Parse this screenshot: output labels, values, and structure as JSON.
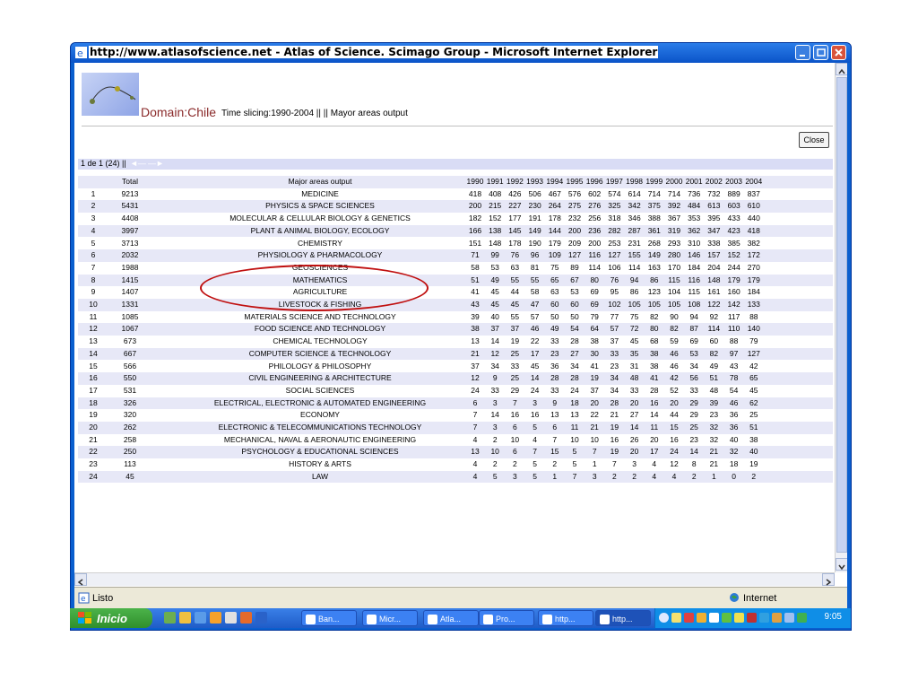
{
  "window": {
    "title": "http://www.atlasofscience.net - Atlas of Science. Scimago Group - Microsoft Internet Explorer"
  },
  "page": {
    "domain_label": "Domain:Chile",
    "time_slicing": "Time slicing:1990-2004 || || Mayor areas output",
    "close_button": "Close",
    "pager_text": "1 de 1 (24) ||"
  },
  "table": {
    "headers": {
      "total": "Total",
      "area": "Major areas output",
      "years": [
        "1990",
        "1991",
        "1992",
        "1993",
        "1994",
        "1995",
        "1996",
        "1997",
        "1998",
        "1999",
        "2000",
        "2001",
        "2002",
        "2003",
        "2004"
      ]
    },
    "rows": [
      {
        "idx": "1",
        "total": "9213",
        "area": "MEDICINE",
        "vals": [
          "418",
          "408",
          "426",
          "506",
          "467",
          "576",
          "602",
          "574",
          "614",
          "714",
          "714",
          "736",
          "732",
          "889",
          "837"
        ]
      },
      {
        "idx": "2",
        "total": "5431",
        "area": "PHYSICS & SPACE SCIENCES",
        "vals": [
          "200",
          "215",
          "227",
          "230",
          "264",
          "275",
          "276",
          "325",
          "342",
          "375",
          "392",
          "484",
          "613",
          "603",
          "610"
        ]
      },
      {
        "idx": "3",
        "total": "4408",
        "area": "MOLECULAR & CELLULAR BIOLOGY & GENETICS",
        "vals": [
          "182",
          "152",
          "177",
          "191",
          "178",
          "232",
          "256",
          "318",
          "346",
          "388",
          "367",
          "353",
          "395",
          "433",
          "440"
        ]
      },
      {
        "idx": "4",
        "total": "3997",
        "area": "PLANT & ANIMAL BIOLOGY, ECOLOGY",
        "vals": [
          "166",
          "138",
          "145",
          "149",
          "144",
          "200",
          "236",
          "282",
          "287",
          "361",
          "319",
          "362",
          "347",
          "423",
          "418"
        ]
      },
      {
        "idx": "5",
        "total": "3713",
        "area": "CHEMISTRY",
        "vals": [
          "151",
          "148",
          "178",
          "190",
          "179",
          "209",
          "200",
          "253",
          "231",
          "268",
          "293",
          "310",
          "338",
          "385",
          "382"
        ]
      },
      {
        "idx": "6",
        "total": "2032",
        "area": "PHYSIOLOGY & PHARMACOLOGY",
        "vals": [
          "71",
          "99",
          "76",
          "96",
          "109",
          "127",
          "116",
          "127",
          "155",
          "149",
          "280",
          "146",
          "157",
          "152",
          "172"
        ]
      },
      {
        "idx": "7",
        "total": "1988",
        "area": "GEOSCIENCES",
        "vals": [
          "58",
          "53",
          "63",
          "81",
          "75",
          "89",
          "114",
          "106",
          "114",
          "163",
          "170",
          "184",
          "204",
          "244",
          "270"
        ]
      },
      {
        "idx": "8",
        "total": "1415",
        "area": "MATHEMATICS",
        "vals": [
          "51",
          "49",
          "55",
          "55",
          "65",
          "67",
          "80",
          "76",
          "94",
          "86",
          "115",
          "116",
          "148",
          "179",
          "179"
        ]
      },
      {
        "idx": "9",
        "total": "1407",
        "area": "AGRICULTURE",
        "vals": [
          "41",
          "45",
          "44",
          "58",
          "63",
          "53",
          "69",
          "95",
          "86",
          "123",
          "104",
          "115",
          "161",
          "160",
          "184"
        ]
      },
      {
        "idx": "10",
        "total": "1331",
        "area": "LIVESTOCK & FISHING",
        "vals": [
          "43",
          "45",
          "45",
          "47",
          "60",
          "60",
          "69",
          "102",
          "105",
          "105",
          "105",
          "108",
          "122",
          "142",
          "133"
        ]
      },
      {
        "idx": "11",
        "total": "1085",
        "area": "MATERIALS SCIENCE AND TECHNOLOGY",
        "vals": [
          "39",
          "40",
          "55",
          "57",
          "50",
          "50",
          "79",
          "77",
          "75",
          "82",
          "90",
          "94",
          "92",
          "117",
          "88"
        ]
      },
      {
        "idx": "12",
        "total": "1067",
        "area": "FOOD SCIENCE AND TECHNOLOGY",
        "vals": [
          "38",
          "37",
          "37",
          "46",
          "49",
          "54",
          "64",
          "57",
          "72",
          "80",
          "82",
          "87",
          "114",
          "110",
          "140"
        ]
      },
      {
        "idx": "13",
        "total": "673",
        "area": "CHEMICAL TECHNOLOGY",
        "vals": [
          "13",
          "14",
          "19",
          "22",
          "33",
          "28",
          "38",
          "37",
          "45",
          "68",
          "59",
          "69",
          "60",
          "88",
          "79"
        ]
      },
      {
        "idx": "14",
        "total": "667",
        "area": "COMPUTER SCIENCE & TECHNOLOGY",
        "vals": [
          "21",
          "12",
          "25",
          "17",
          "23",
          "27",
          "30",
          "33",
          "35",
          "38",
          "46",
          "53",
          "82",
          "97",
          "127"
        ]
      },
      {
        "idx": "15",
        "total": "566",
        "area": "PHILOLOGY & PHILOSOPHY",
        "vals": [
          "37",
          "34",
          "33",
          "45",
          "36",
          "34",
          "41",
          "23",
          "31",
          "38",
          "46",
          "34",
          "49",
          "43",
          "42"
        ]
      },
      {
        "idx": "16",
        "total": "550",
        "area": "CIVIL ENGINEERING & ARCHITECTURE",
        "vals": [
          "12",
          "9",
          "25",
          "14",
          "28",
          "28",
          "19",
          "34",
          "48",
          "41",
          "42",
          "56",
          "51",
          "78",
          "65"
        ]
      },
      {
        "idx": "17",
        "total": "531",
        "area": "SOCIAL SCIENCES",
        "vals": [
          "24",
          "33",
          "29",
          "24",
          "33",
          "24",
          "37",
          "34",
          "33",
          "28",
          "52",
          "33",
          "48",
          "54",
          "45"
        ]
      },
      {
        "idx": "18",
        "total": "326",
        "area": "ELECTRICAL, ELECTRONIC & AUTOMATED ENGINEERING",
        "vals": [
          "6",
          "3",
          "7",
          "3",
          "9",
          "18",
          "20",
          "28",
          "20",
          "16",
          "20",
          "29",
          "39",
          "46",
          "62"
        ]
      },
      {
        "idx": "19",
        "total": "320",
        "area": "ECONOMY",
        "vals": [
          "7",
          "14",
          "16",
          "16",
          "13",
          "13",
          "22",
          "21",
          "27",
          "14",
          "44",
          "29",
          "23",
          "36",
          "25"
        ]
      },
      {
        "idx": "20",
        "total": "262",
        "area": "ELECTRONIC & TELECOMMUNICATIONS TECHNOLOGY",
        "vals": [
          "7",
          "3",
          "6",
          "5",
          "6",
          "11",
          "21",
          "19",
          "14",
          "11",
          "15",
          "25",
          "32",
          "36",
          "51"
        ]
      },
      {
        "idx": "21",
        "total": "258",
        "area": "MECHANICAL, NAVAL & AERONAUTIC ENGINEERING",
        "vals": [
          "4",
          "2",
          "10",
          "4",
          "7",
          "10",
          "10",
          "16",
          "26",
          "20",
          "16",
          "23",
          "32",
          "40",
          "38"
        ]
      },
      {
        "idx": "22",
        "total": "250",
        "area": "PSYCHOLOGY & EDUCATIONAL SCIENCES",
        "vals": [
          "13",
          "10",
          "6",
          "7",
          "15",
          "5",
          "7",
          "19",
          "20",
          "17",
          "24",
          "14",
          "21",
          "32",
          "40"
        ]
      },
      {
        "idx": "23",
        "total": "113",
        "area": "HISTORY & ARTS",
        "vals": [
          "4",
          "2",
          "2",
          "5",
          "2",
          "5",
          "1",
          "7",
          "3",
          "4",
          "12",
          "8",
          "21",
          "18",
          "19"
        ]
      },
      {
        "idx": "24",
        "total": "45",
        "area": "LAW",
        "vals": [
          "4",
          "5",
          "3",
          "5",
          "1",
          "7",
          "3",
          "2",
          "2",
          "4",
          "4",
          "2",
          "1",
          "0",
          "2"
        ]
      }
    ]
  },
  "statusbar": {
    "status": "Listo",
    "zone": "Internet"
  },
  "taskbar": {
    "start": "Inicio",
    "tasks": [
      "Ban...",
      "Micr...",
      "Atla...",
      "Pro...",
      "http...",
      "http..."
    ],
    "clock": "9:05"
  },
  "colors": {
    "highlight_ellipse": "#c01010",
    "header_row": "#e7e8f7",
    "pager_bar": "#d9dcf5"
  }
}
